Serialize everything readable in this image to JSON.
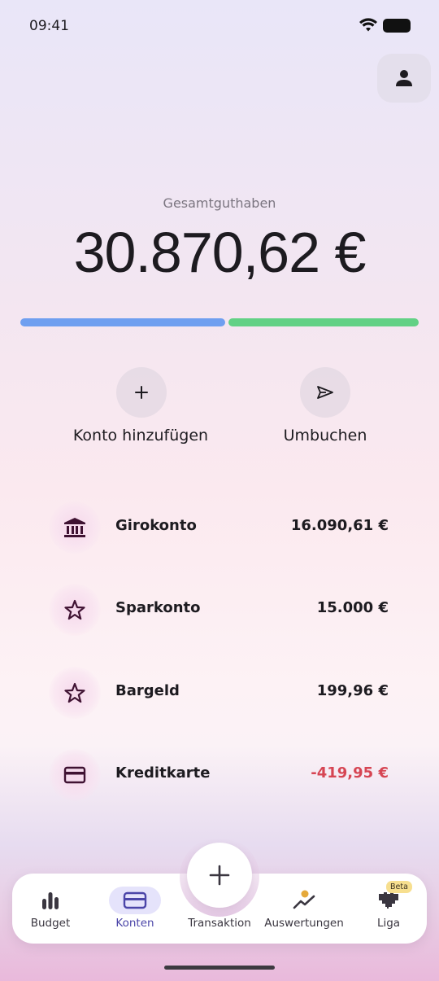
{
  "status_bar": {
    "time": "09:41"
  },
  "header": {
    "profile_icon": "person-icon"
  },
  "balance": {
    "label": "Gesamtguthaben",
    "amount": "30.870,62 €"
  },
  "actions": [
    {
      "label": "Konto hinzufügen",
      "icon": "plus-icon"
    },
    {
      "label": "Umbuchen",
      "icon": "send-icon"
    }
  ],
  "accounts": [
    {
      "name": "Girokonto",
      "value": "16.090,61 €",
      "icon": "bank-icon"
    },
    {
      "name": "Sparkonto",
      "value": "15.000 €",
      "icon": "star-icon"
    },
    {
      "name": "Bargeld",
      "value": "199,96 €",
      "icon": "star-icon"
    },
    {
      "name": "Kreditkarte",
      "value": "-419,95 €",
      "icon": "credit-card-icon"
    }
  ],
  "nav": {
    "items": [
      {
        "label": "Budget",
        "icon": "bar-chart-icon"
      },
      {
        "label": "Konten",
        "icon": "credit-card-icon"
      },
      {
        "label": "Transaktion",
        "icon": "plus-icon"
      },
      {
        "label": "Auswertungen",
        "icon": "trend-icon"
      },
      {
        "label": "Liga",
        "icon": "heart-icon"
      }
    ],
    "active": "Konten",
    "badge": "Beta"
  },
  "colors": {
    "accent": "#4b45a8",
    "bar_blue": "#6f9ff0",
    "bar_green": "#62d185",
    "negative": "#d64553",
    "icon": "#3f1232"
  }
}
